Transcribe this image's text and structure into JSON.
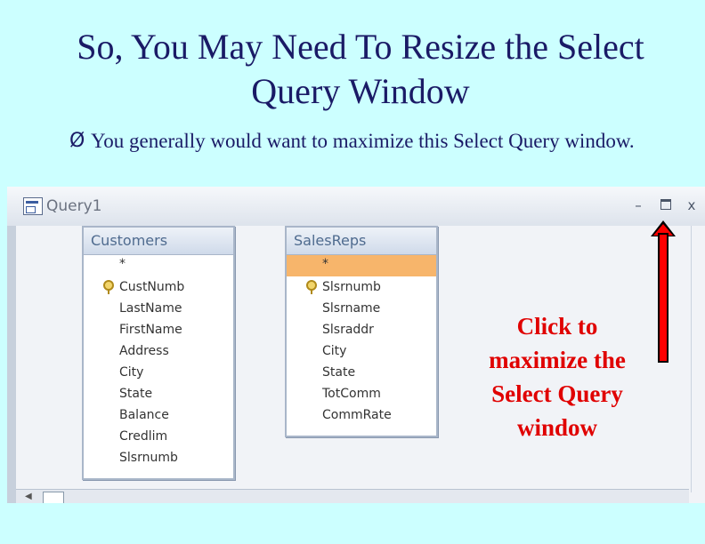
{
  "slide": {
    "title_line1": "So, You May Need To Resize the Select",
    "title_line2": "Query Window",
    "bullet_mark": "Ø",
    "bullet_text": "You generally would want to maximize this Select Query window.",
    "callout": [
      "Click to",
      "maximize the",
      "Select Query",
      "window"
    ]
  },
  "window": {
    "title": "Query1",
    "min_glyph": "–",
    "close_glyph": "x"
  },
  "tables": {
    "customers": {
      "name": "Customers",
      "fields": [
        "*",
        "CustNumb",
        "LastName",
        "FirstName",
        "Address",
        "City",
        "State",
        "Balance",
        "Credlim",
        "Slsrnumb"
      ]
    },
    "salesreps": {
      "name": "SalesReps",
      "fields": [
        "*",
        "Slsrnumb",
        "Slsrname",
        "Slsraddr",
        "City",
        "State",
        "TotComm",
        "CommRate"
      ]
    }
  },
  "colors": {
    "slide_bg": "#ccffff",
    "callout": "#e00000",
    "selected_row": "#f7b56b"
  }
}
